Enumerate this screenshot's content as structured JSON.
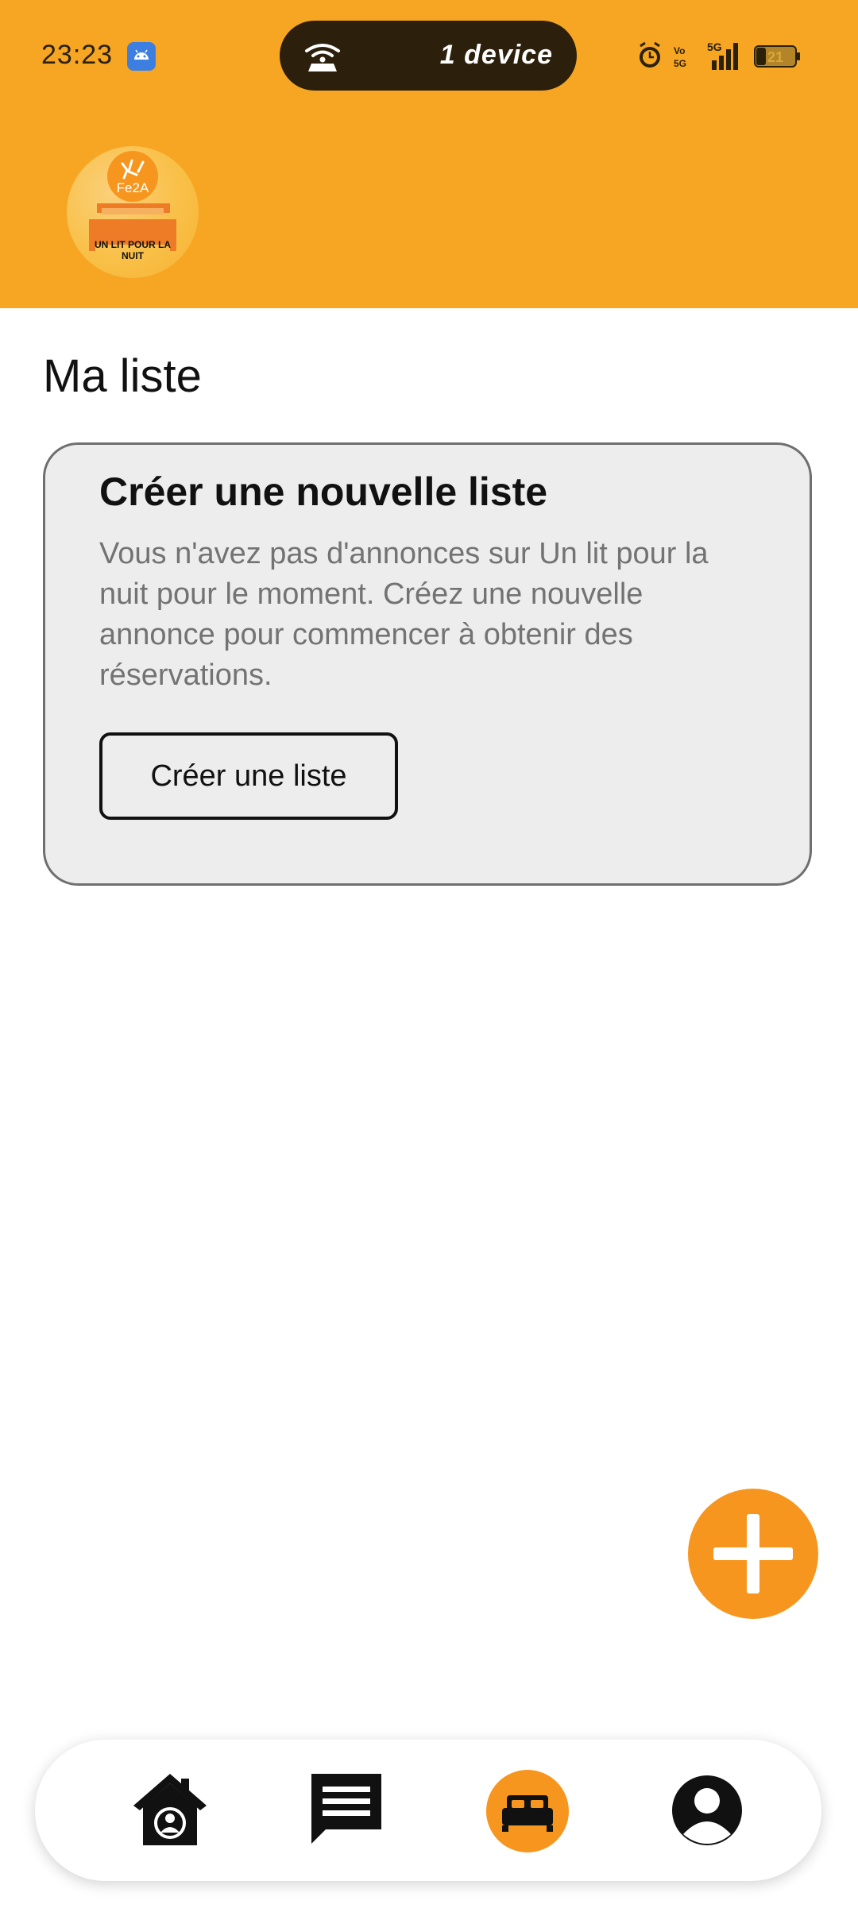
{
  "status_bar": {
    "time": "23:23",
    "pill_text": "1 device",
    "battery": "21",
    "network": "5G",
    "volte": "Vo 5G"
  },
  "header": {
    "logo_text_top": "Fe2A",
    "logo_text_bottom": "UN LIT POUR LA NUIT",
    "background_color": "#F7A623"
  },
  "main": {
    "title": "Ma liste",
    "card": {
      "heading": "Créer une nouvelle liste",
      "description": "Vous n'avez pas d'annonces sur Un lit pour la nuit pour le moment. Créez une nouvelle annonce pour commencer à obtenir des réservations.",
      "button_label": "Créer une liste"
    }
  },
  "fab": {
    "icon": "plus-icon",
    "color": "#F7961E"
  },
  "bottom_nav": {
    "items": [
      {
        "icon": "home-icon",
        "active": false
      },
      {
        "icon": "chat-icon",
        "active": false
      },
      {
        "icon": "bed-icon",
        "active": true
      },
      {
        "icon": "profile-icon",
        "active": false
      }
    ],
    "accent_color": "#F7961E"
  }
}
